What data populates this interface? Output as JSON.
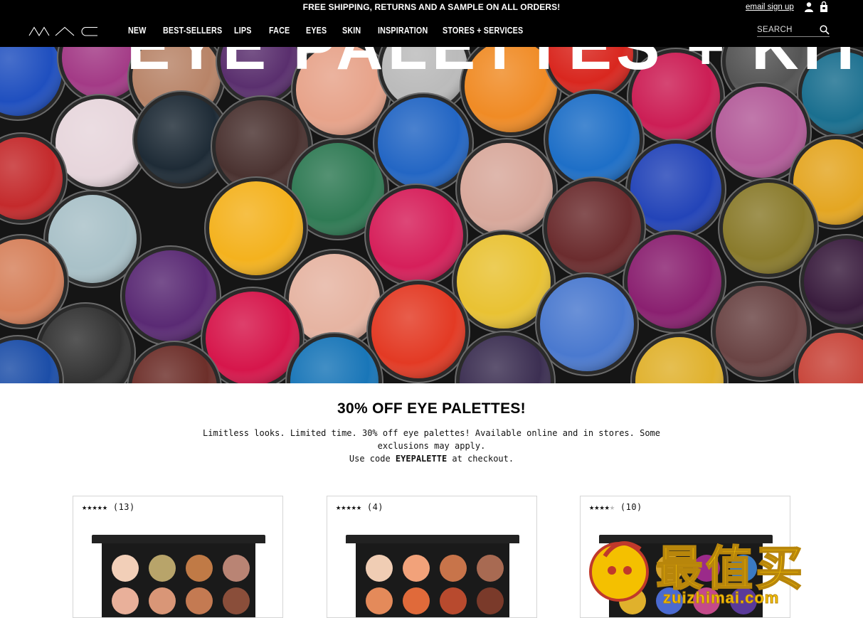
{
  "header": {
    "promo": "FREE SHIPPING, RETURNS AND A SAMPLE ON ALL ORDERS!",
    "email_signup": "email sign up",
    "logo_text": "MAC",
    "nav": [
      "NEW",
      "BEST-SELLERS",
      "LIPS",
      "FACE",
      "EYES",
      "SKIN",
      "INSPIRATION",
      "STORES + SERVICES"
    ],
    "search_placeholder": "SEARCH"
  },
  "hero": {
    "title": "EYE PALETTES + KITS"
  },
  "promo": {
    "headline": "30% OFF EYE PALETTES!",
    "line1": "Limitless looks. Limited time. 30% off eye palettes! Available online and in stores. Some exclusions may apply.",
    "code_prefix": "Use code ",
    "code": "EYEPALETTE",
    "code_suffix": " at checkout."
  },
  "products": [
    {
      "stars": "★★★★★",
      "stars_off": "",
      "review_count": "(13)",
      "rating": 5
    },
    {
      "stars": "★★★★★",
      "stars_off": "",
      "review_count": "(4)",
      "rating": 5
    },
    {
      "stars": "★★★★",
      "stars_off": "★",
      "review_count": "(10)",
      "rating": 4
    }
  ],
  "watermark": {
    "text": "最值买",
    "url": "zuizhimai.com"
  },
  "colors": {
    "header_bg": "#000000",
    "text": "#111111",
    "card_border": "#d5d5d5",
    "watermark": "#f4c000"
  },
  "icons": [
    "user-icon",
    "shopping-bag-icon",
    "search-icon"
  ]
}
